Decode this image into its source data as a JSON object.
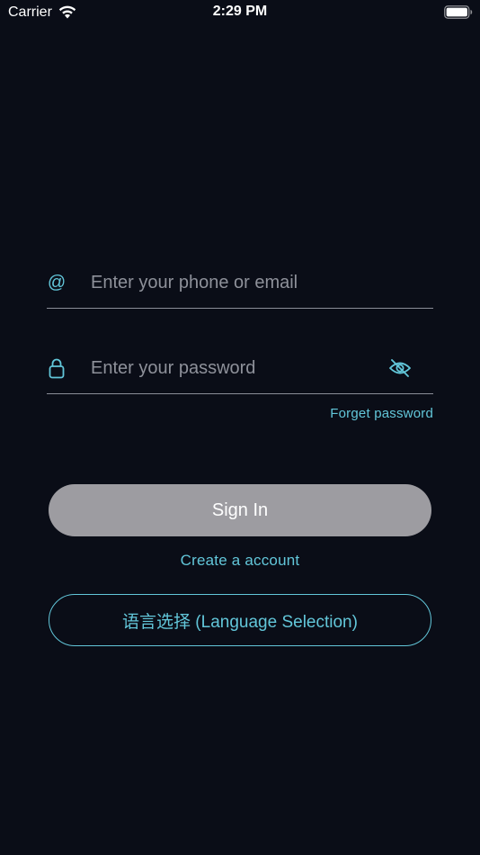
{
  "status_bar": {
    "carrier": "Carrier",
    "time": "2:29 PM"
  },
  "login": {
    "email_placeholder": "Enter your phone or email",
    "email_icon": "@",
    "password_placeholder": "Enter your password",
    "forgot_password": "Forget password",
    "sign_in": "Sign In",
    "create_account": "Create a account",
    "language_selection": "语言选择 (Language Selection)"
  },
  "colors": {
    "background": "#0a0d17",
    "accent": "#62c6d9",
    "button_disabled": "#9d9ca1",
    "divider": "#8a8d97",
    "placeholder": "#8e919a"
  }
}
